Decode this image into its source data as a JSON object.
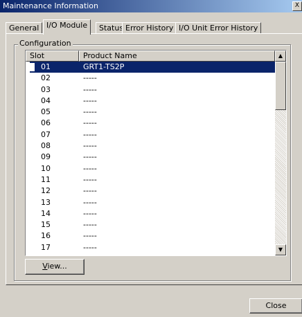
{
  "window": {
    "title": "Maintenance Information",
    "close_glyph": "X"
  },
  "tabs": [
    {
      "label": "General",
      "active": false
    },
    {
      "label": "I/O Module",
      "active": true
    },
    {
      "label": "Status",
      "active": false
    },
    {
      "label": "Error History",
      "active": false
    },
    {
      "label": "I/O Unit Error History",
      "active": false
    }
  ],
  "configuration": {
    "group_label": "Configuration",
    "columns": {
      "slot": "Slot",
      "product_name": "Product Name"
    },
    "rows": [
      {
        "slot": "01",
        "product_name": "GRT1-TS2P",
        "selected": true
      },
      {
        "slot": "02",
        "product_name": "-----"
      },
      {
        "slot": "03",
        "product_name": "-----"
      },
      {
        "slot": "04",
        "product_name": "-----"
      },
      {
        "slot": "05",
        "product_name": "-----"
      },
      {
        "slot": "06",
        "product_name": "-----"
      },
      {
        "slot": "07",
        "product_name": "-----"
      },
      {
        "slot": "08",
        "product_name": "-----"
      },
      {
        "slot": "09",
        "product_name": "-----"
      },
      {
        "slot": "10",
        "product_name": "-----"
      },
      {
        "slot": "11",
        "product_name": "-----"
      },
      {
        "slot": "12",
        "product_name": "-----"
      },
      {
        "slot": "13",
        "product_name": "-----"
      },
      {
        "slot": "14",
        "product_name": "-----"
      },
      {
        "slot": "15",
        "product_name": "-----"
      },
      {
        "slot": "16",
        "product_name": "-----"
      },
      {
        "slot": "17",
        "product_name": "-----"
      }
    ]
  },
  "buttons": {
    "view_mnemonic": "V",
    "view_rest": "iew...",
    "close": "Close"
  },
  "icons": {
    "scroll_up": "scroll-up-arrow-icon",
    "scroll_down": "scroll-down-arrow-icon"
  },
  "colors": {
    "selection": "#0a246a",
    "face": "#d4d0c8"
  }
}
